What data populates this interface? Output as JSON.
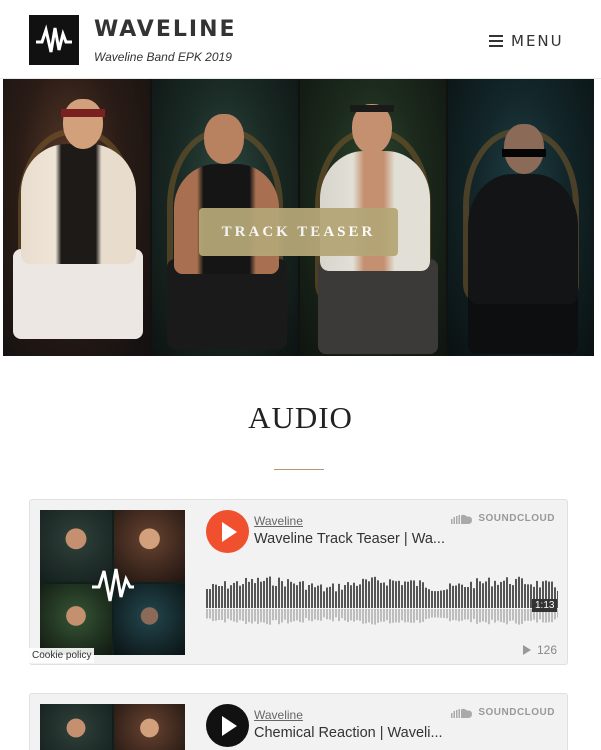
{
  "header": {
    "brand_title": "WAVELINE",
    "brand_subtitle": "Waveline Band EPK 2019",
    "menu_label": "MENU",
    "menu_icon": "hamburger-icon",
    "logo_icon": "waveform-logo-icon"
  },
  "hero": {
    "button_label": "TRACK TEASER",
    "button_color": "#b4a676"
  },
  "audio": {
    "heading": "AUDIO",
    "rule_color": "#b39575"
  },
  "players": [
    {
      "artist": "Waveline",
      "track": "Waveline Track Teaser | Wa...",
      "brand": "SOUNDCLOUD",
      "time": "1:13",
      "plays": "126",
      "play_color": "#f1502f"
    },
    {
      "artist": "Waveline",
      "track": "Chemical Reaction | Waveli...",
      "brand": "SOUNDCLOUD",
      "play_color": "#111111"
    }
  ],
  "cookie": "Cookie policy"
}
